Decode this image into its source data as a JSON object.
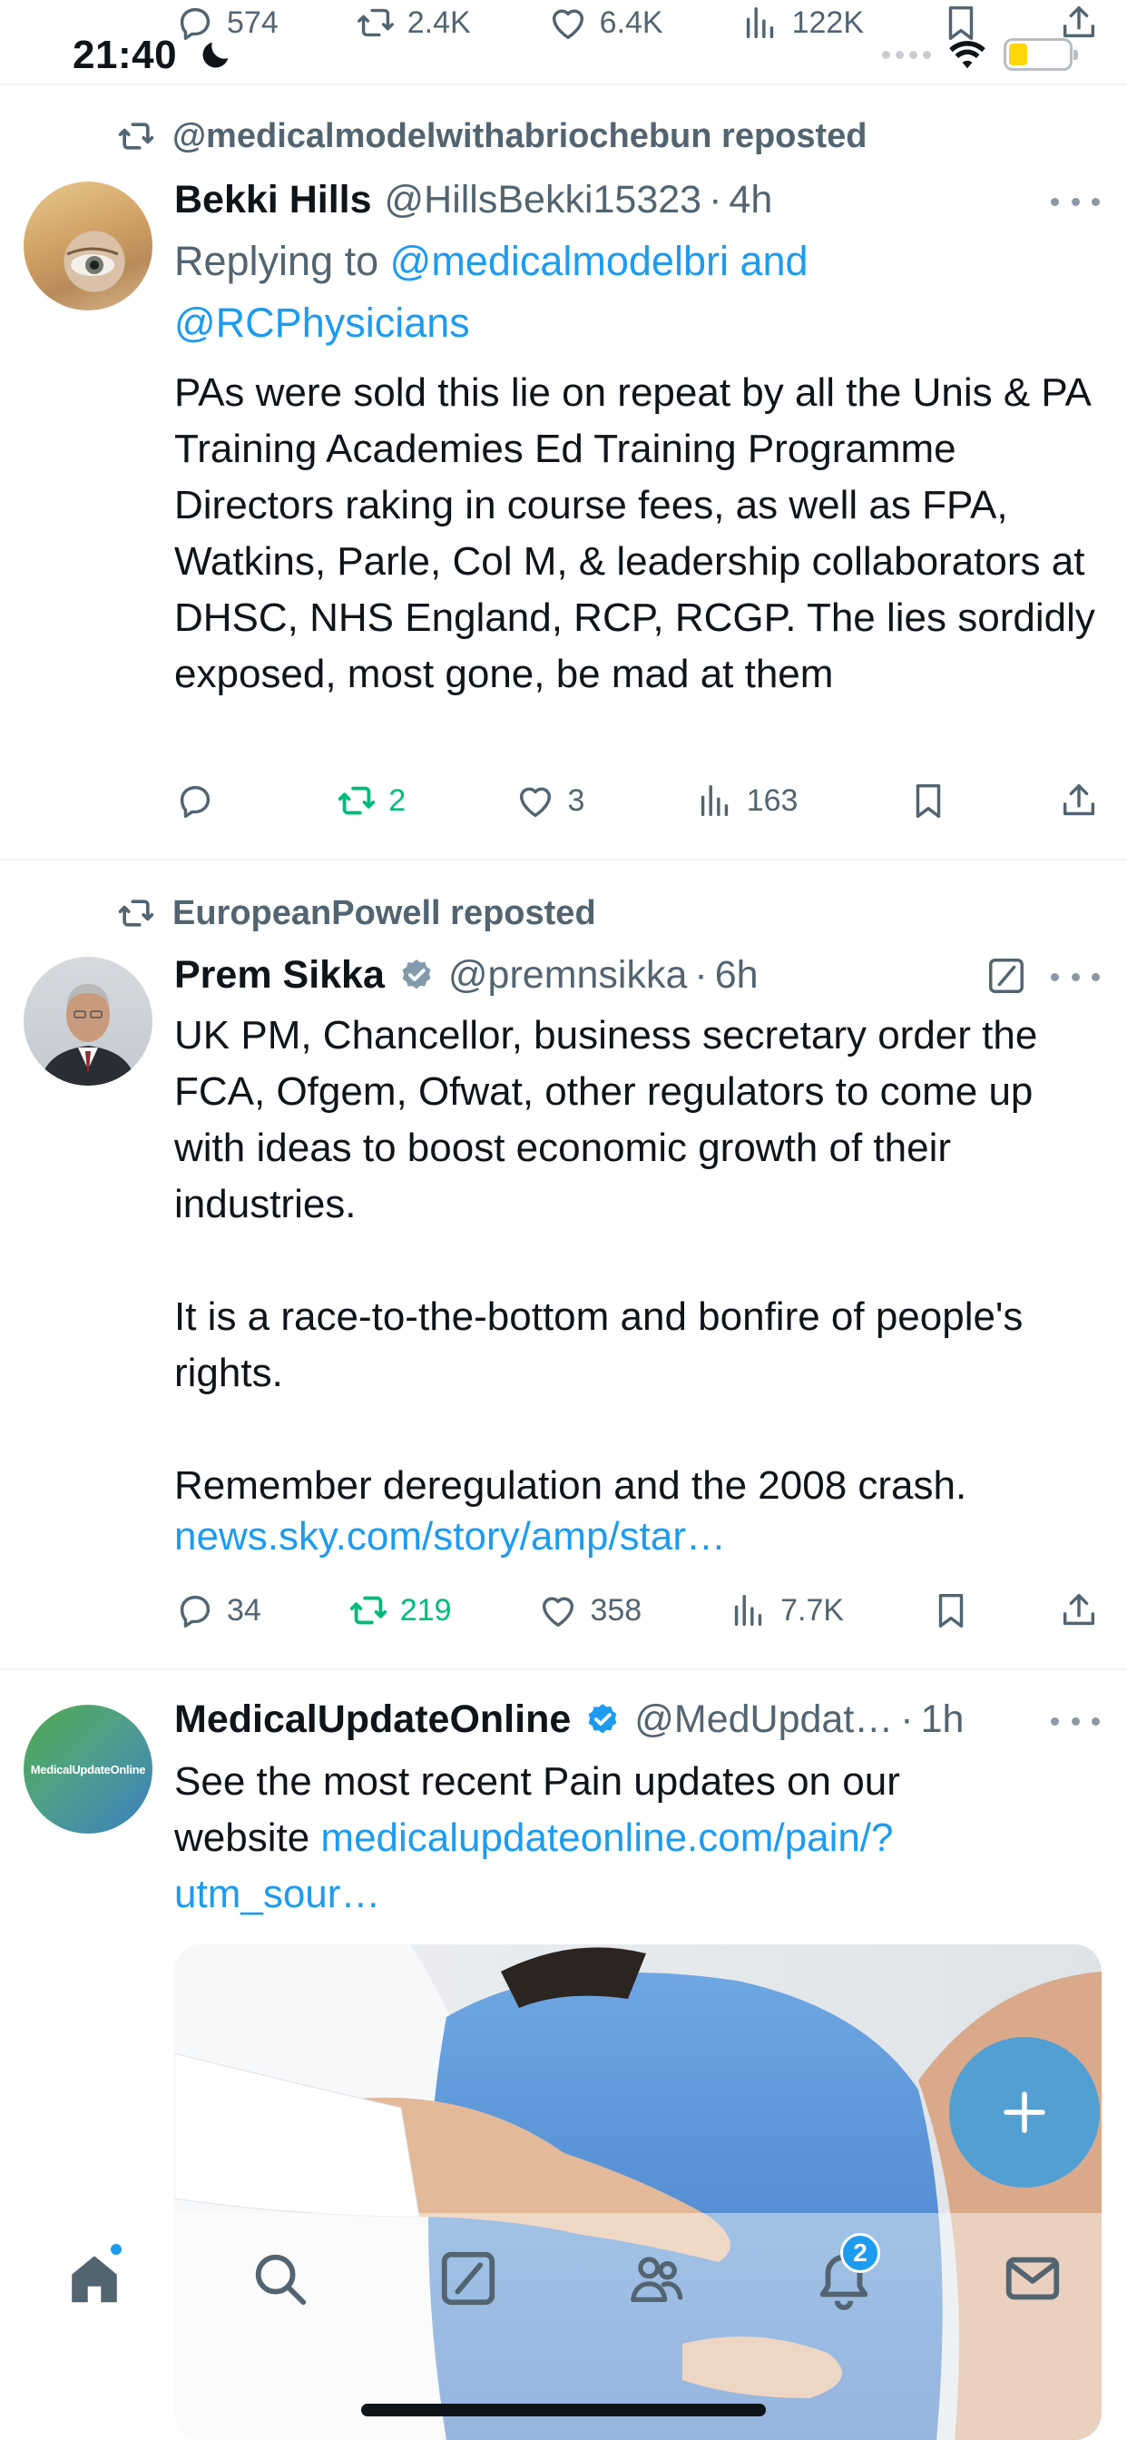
{
  "status_bar": {
    "time": "21:40"
  },
  "previous_tweet_actions": {
    "replies": "574",
    "reposts": "2.4K",
    "likes": "6.4K",
    "views": "122K"
  },
  "tweets": [
    {
      "repost_by": "@medicalmodelwithabriochebun reposted",
      "name": "Bekki Hills",
      "handle": "@HillsBekki15323",
      "age": "4h",
      "replying_prefix": "Replying to ",
      "replying_to": "@medicalmodelbri and @RCPhysicians",
      "text": "PAs were sold this lie on repeat by all the Unis & PA Training Academies Ed Training Programme Directors raking in course fees, as well as FPA, Watkins, Parle, Col M, & leadership collaborators at DHSC, NHS England, RCP, RCGP. The lies sordidly exposed, most gone, be mad at them",
      "replies": "",
      "reposts": "2",
      "likes": "3",
      "views": "163"
    },
    {
      "repost_by": "EuropeanPowell reposted",
      "name": "Prem Sikka",
      "handle": "@premnsikka",
      "age": "6h",
      "text": "UK PM, Chancellor, business secretary order the FCA, Ofgem, Ofwat, other regulators to come up with ideas to boost economic growth of their industries.\n\nIt is a race-to-the-bottom and bonfire of people's rights.\n\nRemember deregulation and the 2008 crash.",
      "link": "news.sky.com/story/amp/star…",
      "replies": "34",
      "reposts": "219",
      "likes": "358",
      "views": "7.7K"
    },
    {
      "name": "MedicalUpdateOnline",
      "handle": "@MedUpdat…",
      "age": "1h",
      "avatar_text": "MedicalUpdateOnline",
      "text": "See the most recent Pain updates on our website ",
      "link": "medicalupdateonline.com/pain/?utm_sour…"
    }
  ],
  "bottom_nav": {
    "notifications_count": "2"
  },
  "colors": {
    "accent": "#1d9bf0",
    "repost_green": "#00ba7c",
    "secondary_text": "#536471"
  }
}
